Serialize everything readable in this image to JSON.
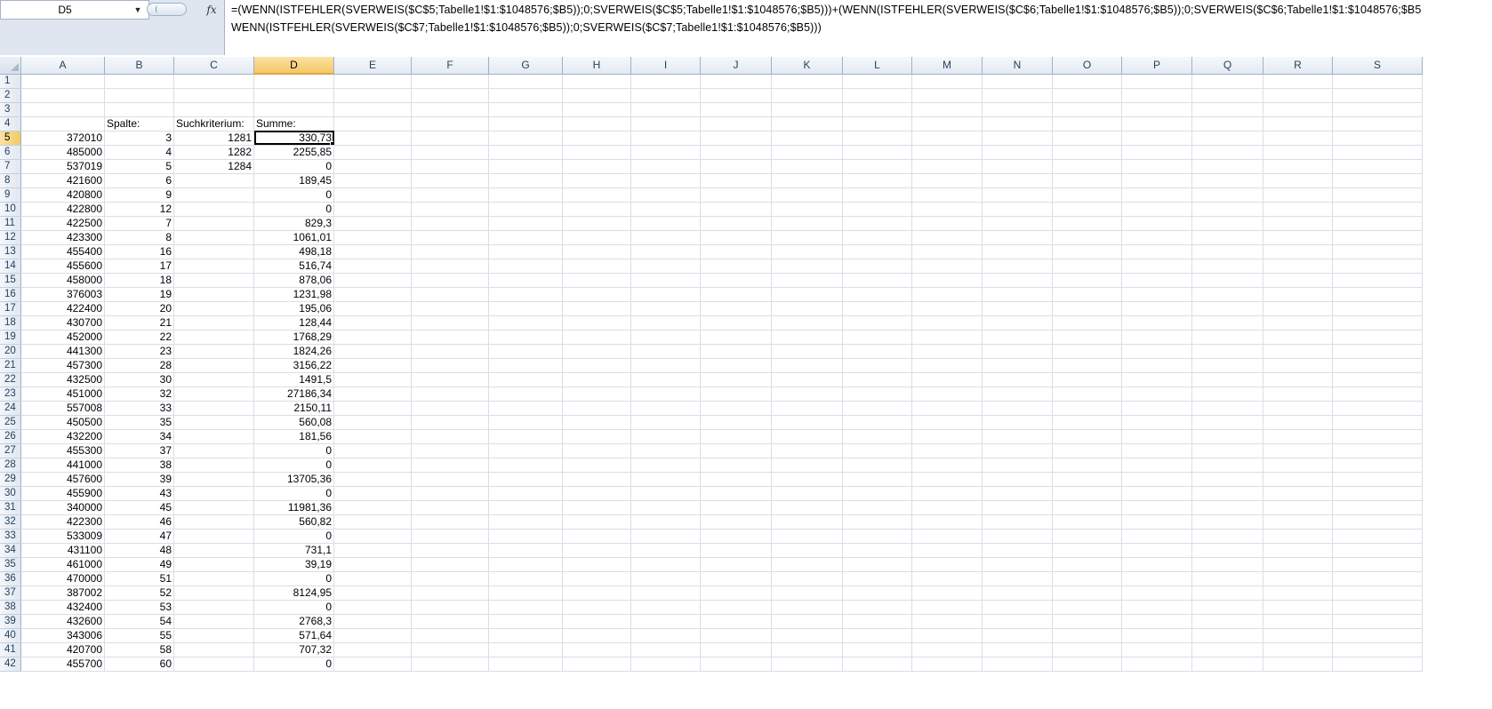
{
  "name_box": {
    "value": "D5",
    "dropdown_icon": "triangle-down-icon"
  },
  "formula_bar": {
    "fx_label": "fx",
    "line1": "=(WENN(ISTFEHLER(SVERWEIS($C$5;Tabelle1!$1:$1048576;$B5));0;SVERWEIS($C$5;Tabelle1!$1:$1048576;$B5)))+(WENN(ISTFEHLER(SVERWEIS($C$6;Tabelle1!$1:$1048576;$B5));0;SVERWEIS($C$6;Tabelle1!$1:$1048576;$B5",
    "line2": "WENN(ISTFEHLER(SVERWEIS($C$7;Tabelle1!$1:$1048576;$B5));0;SVERWEIS($C$7;Tabelle1!$1:$1048576;$B5)))"
  },
  "columns": [
    "A",
    "B",
    "C",
    "D",
    "E",
    "F",
    "G",
    "H",
    "I",
    "J",
    "K",
    "L",
    "M",
    "N",
    "O",
    "P",
    "Q",
    "R",
    "S"
  ],
  "active_cell": {
    "col": "D",
    "row": 5
  },
  "rows": [
    {
      "row": "1",
      "a": "",
      "b": "",
      "c": "",
      "d": ""
    },
    {
      "row": "2",
      "a": "",
      "b": "",
      "c": "",
      "d": ""
    },
    {
      "row": "3",
      "a": "",
      "b": "",
      "c": "",
      "d": ""
    },
    {
      "row": "4",
      "a": "",
      "b": "Spalte:",
      "c": "Suchkriterium:",
      "d": "Summe:"
    },
    {
      "row": "5",
      "a": "372010",
      "b": "3",
      "c": "1281",
      "d": "330,73"
    },
    {
      "row": "6",
      "a": "485000",
      "b": "4",
      "c": "1282",
      "d": "2255,85"
    },
    {
      "row": "7",
      "a": "537019",
      "b": "5",
      "c": "1284",
      "d": "0"
    },
    {
      "row": "8",
      "a": "421600",
      "b": "6",
      "c": "",
      "d": "189,45"
    },
    {
      "row": "9",
      "a": "420800",
      "b": "9",
      "c": "",
      "d": "0"
    },
    {
      "row": "10",
      "a": "422800",
      "b": "12",
      "c": "",
      "d": "0"
    },
    {
      "row": "11",
      "a": "422500",
      "b": "7",
      "c": "",
      "d": "829,3"
    },
    {
      "row": "12",
      "a": "423300",
      "b": "8",
      "c": "",
      "d": "1061,01"
    },
    {
      "row": "13",
      "a": "455400",
      "b": "16",
      "c": "",
      "d": "498,18"
    },
    {
      "row": "14",
      "a": "455600",
      "b": "17",
      "c": "",
      "d": "516,74"
    },
    {
      "row": "15",
      "a": "458000",
      "b": "18",
      "c": "",
      "d": "878,06"
    },
    {
      "row": "16",
      "a": "376003",
      "b": "19",
      "c": "",
      "d": "1231,98"
    },
    {
      "row": "17",
      "a": "422400",
      "b": "20",
      "c": "",
      "d": "195,06"
    },
    {
      "row": "18",
      "a": "430700",
      "b": "21",
      "c": "",
      "d": "128,44"
    },
    {
      "row": "19",
      "a": "452000",
      "b": "22",
      "c": "",
      "d": "1768,29"
    },
    {
      "row": "20",
      "a": "441300",
      "b": "23",
      "c": "",
      "d": "1824,26"
    },
    {
      "row": "21",
      "a": "457300",
      "b": "28",
      "c": "",
      "d": "3156,22"
    },
    {
      "row": "22",
      "a": "432500",
      "b": "30",
      "c": "",
      "d": "1491,5"
    },
    {
      "row": "23",
      "a": "451000",
      "b": "32",
      "c": "",
      "d": "27186,34"
    },
    {
      "row": "24",
      "a": "557008",
      "b": "33",
      "c": "",
      "d": "2150,11"
    },
    {
      "row": "25",
      "a": "450500",
      "b": "35",
      "c": "",
      "d": "560,08"
    },
    {
      "row": "26",
      "a": "432200",
      "b": "34",
      "c": "",
      "d": "181,56"
    },
    {
      "row": "27",
      "a": "455300",
      "b": "37",
      "c": "",
      "d": "0"
    },
    {
      "row": "28",
      "a": "441000",
      "b": "38",
      "c": "",
      "d": "0"
    },
    {
      "row": "29",
      "a": "457600",
      "b": "39",
      "c": "",
      "d": "13705,36"
    },
    {
      "row": "30",
      "a": "455900",
      "b": "43",
      "c": "",
      "d": "0"
    },
    {
      "row": "31",
      "a": "340000",
      "b": "45",
      "c": "",
      "d": "11981,36"
    },
    {
      "row": "32",
      "a": "422300",
      "b": "46",
      "c": "",
      "d": "560,82"
    },
    {
      "row": "33",
      "a": "533009",
      "b": "47",
      "c": "",
      "d": "0"
    },
    {
      "row": "34",
      "a": "431100",
      "b": "48",
      "c": "",
      "d": "731,1"
    },
    {
      "row": "35",
      "a": "461000",
      "b": "49",
      "c": "",
      "d": "39,19"
    },
    {
      "row": "36",
      "a": "470000",
      "b": "51",
      "c": "",
      "d": "0"
    },
    {
      "row": "37",
      "a": "387002",
      "b": "52",
      "c": "",
      "d": "8124,95"
    },
    {
      "row": "38",
      "a": "432400",
      "b": "53",
      "c": "",
      "d": "0"
    },
    {
      "row": "39",
      "a": "432600",
      "b": "54",
      "c": "",
      "d": "2768,3"
    },
    {
      "row": "40",
      "a": "343006",
      "b": "55",
      "c": "",
      "d": "571,64"
    },
    {
      "row": "41",
      "a": "420700",
      "b": "58",
      "c": "",
      "d": "707,32"
    },
    {
      "row": "42",
      "a": "455700",
      "b": "60",
      "c": "",
      "d": "0"
    }
  ]
}
